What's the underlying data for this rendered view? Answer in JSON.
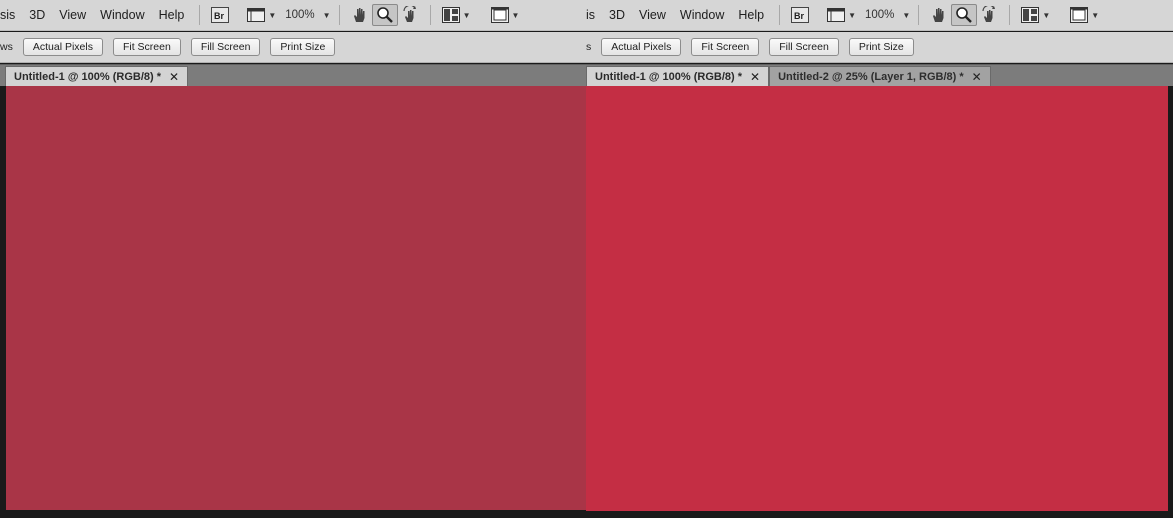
{
  "panes": [
    {
      "menu": [
        "sis",
        "3D",
        "View",
        "Window",
        "Help"
      ],
      "zoom": "100%",
      "options_lead": "ws",
      "option_buttons": [
        "Actual Pixels",
        "Fit Screen",
        "Fill Screen",
        "Print Size"
      ],
      "tabs": [
        {
          "label": "Untitled-1 @ 100% (RGB/8) *",
          "active": true
        }
      ],
      "canvas_color": "#a93547"
    },
    {
      "menu": [
        "is",
        "3D",
        "View",
        "Window",
        "Help"
      ],
      "zoom": "100%",
      "options_lead": "s",
      "option_buttons": [
        "Actual Pixels",
        "Fit Screen",
        "Fill Screen",
        "Print Size"
      ],
      "tabs": [
        {
          "label": "Untitled-1 @ 100% (RGB/8) *",
          "active": true
        },
        {
          "label": "Untitled-2 @ 25% (Layer 1, RGB/8) *",
          "active": false
        }
      ],
      "canvas_color": "#c42e44"
    }
  ],
  "icons": {
    "bridge": "Br",
    "close": "✕"
  }
}
